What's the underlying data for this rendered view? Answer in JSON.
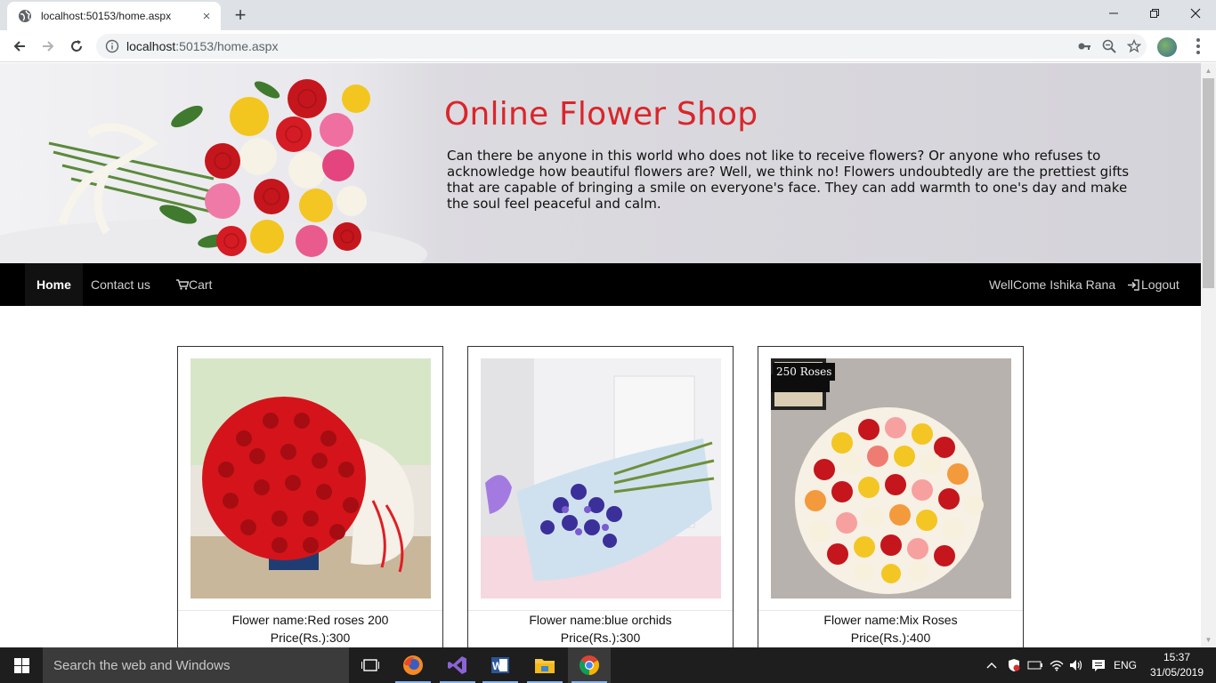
{
  "browser": {
    "tab_title": "localhost:50153/home.aspx",
    "url_host": "localhost",
    "url_rest": ":50153/home.aspx",
    "new_tab": "+",
    "tab_close": "×"
  },
  "page": {
    "title": "Online Flower Shop",
    "description": "Can there be anyone in this world who does not like to receive flowers? Or anyone who refuses to acknowledge how beautiful flowers are? Well, we think no! Flowers undoubtedly are the prettiest gifts that are capable of bringing a smile on everyone's face. They can add warmth to one's day and make the soul feel peaceful and calm."
  },
  "nav": {
    "home": "Home",
    "contact": "Contact us",
    "cart": "Cart",
    "welcome": "WellCome Ishika Rana",
    "logout": "Logout"
  },
  "products": [
    {
      "name": "Flower name:Red roses 200",
      "price": "Price(Rs.):300"
    },
    {
      "name": "Flower name:blue orchids",
      "price": "Price(Rs.):300"
    },
    {
      "name": "Flower name:Mix Roses",
      "price": "Price(Rs.):400",
      "tag": "250 Roses"
    }
  ],
  "taskbar": {
    "search_placeholder": "Search the web and Windows",
    "language": "ENG",
    "time": "15:37",
    "date": "31/05/2019"
  }
}
